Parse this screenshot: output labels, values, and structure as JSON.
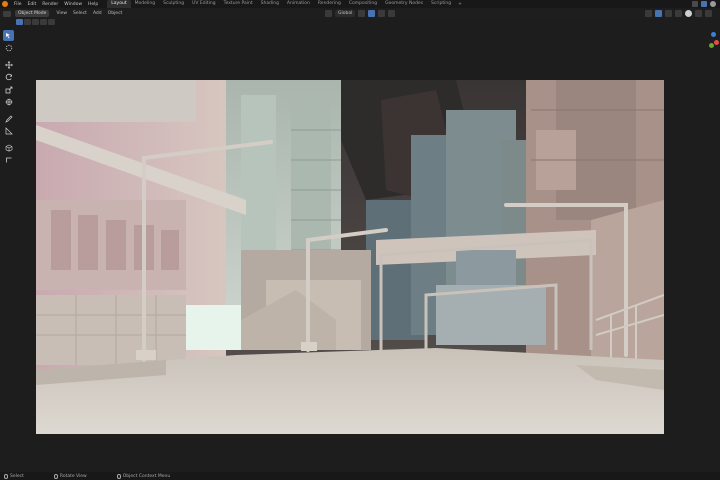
{
  "topbar": {
    "menus": [
      "File",
      "Edit",
      "Render",
      "Window",
      "Help"
    ],
    "workspaces": [
      "Layout",
      "Modeling",
      "Sculpting",
      "UV Editing",
      "Texture Paint",
      "Shading",
      "Animation",
      "Rendering",
      "Compositing",
      "Geometry Nodes",
      "Scripting"
    ],
    "active_workspace": "Layout",
    "add_workspace_label": "+"
  },
  "viewport_header": {
    "mode": "Object Mode",
    "menus": [
      "View",
      "Select",
      "Add",
      "Object"
    ],
    "transform_orientation": "Global"
  },
  "toolbar": {
    "tools": [
      "select-box",
      "cursor",
      "move",
      "rotate",
      "scale",
      "transform",
      "annotate",
      "measure",
      "add-cube"
    ],
    "active_tool": "select-box"
  },
  "statusbar": {
    "items": [
      "Select",
      "Rotate View",
      "Object Context Menu"
    ]
  },
  "colors": {
    "accent": "#4772b3",
    "blender_orange": "#e87d0d",
    "gizmo_x": "#e54d4d",
    "gizmo_y": "#6ba32b",
    "gizmo_z": "#3e7fd6"
  }
}
